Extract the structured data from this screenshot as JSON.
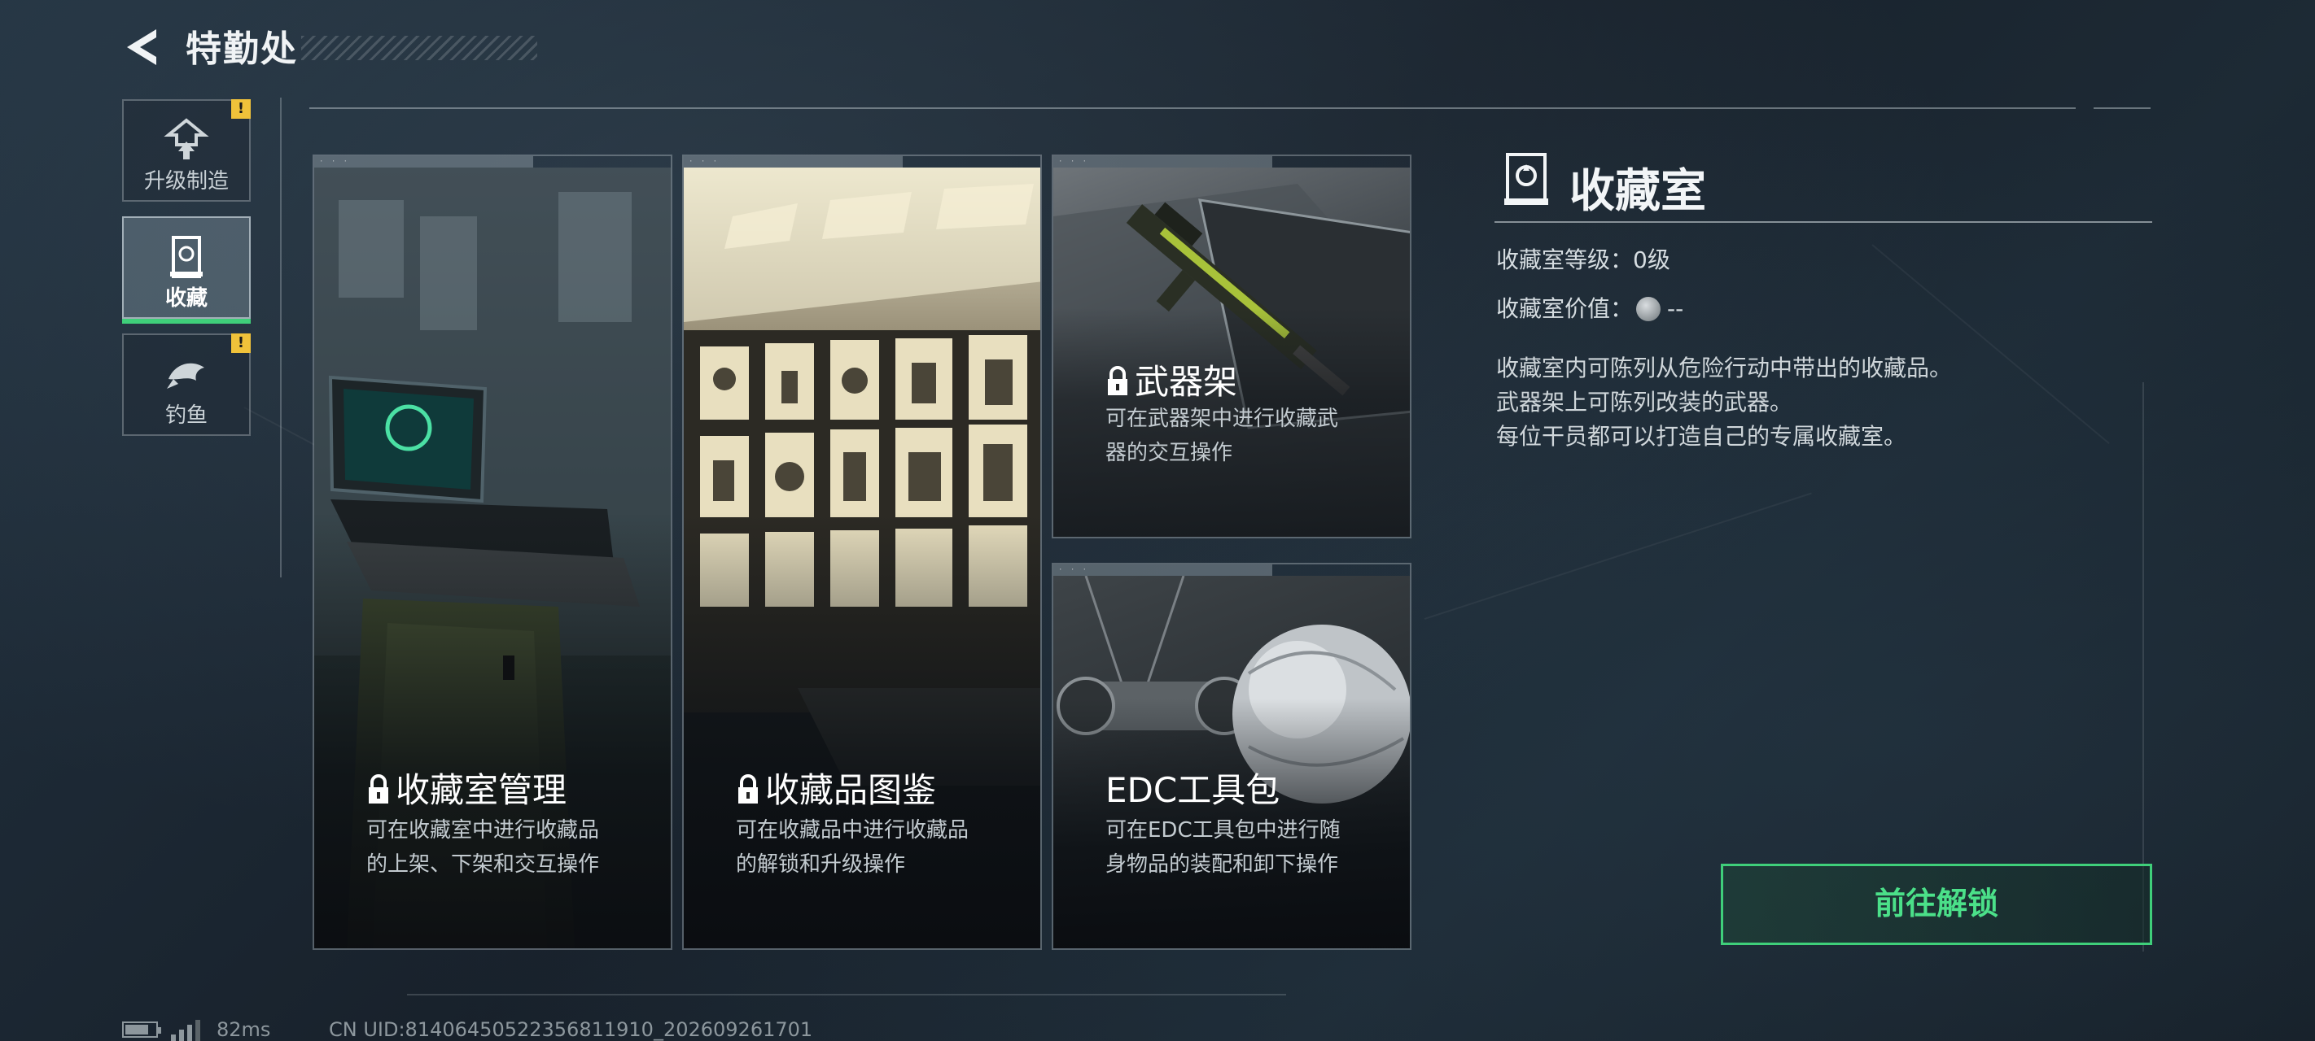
{
  "header": {
    "title": "特勤处",
    "back_icon": "back-arrow-icon"
  },
  "sidebar": {
    "items": [
      {
        "label": "升级制造",
        "icon": "upgrade-icon",
        "badge": "!",
        "active": false
      },
      {
        "label": "收藏",
        "icon": "collection-icon",
        "badge": "",
        "active": true
      },
      {
        "label": "钓鱼",
        "icon": "fish-icon",
        "badge": "!",
        "active": false
      }
    ]
  },
  "cards": [
    {
      "title": "收藏室管理",
      "locked": true,
      "desc": "可在收藏室中进行收藏品\n的上架、下架和交互操作"
    },
    {
      "title": "收藏品图鉴",
      "locked": true,
      "desc": "可在收藏品中进行收藏品\n的解锁和升级操作"
    },
    {
      "title": "武器架",
      "locked": true,
      "desc": "可在武器架中进行收藏武\n器的交互操作"
    },
    {
      "title": "EDC工具包",
      "locked": false,
      "desc": "可在EDC工具包中进行随\n身物品的装配和卸下操作"
    }
  ],
  "panel": {
    "title": "收藏室",
    "icon": "collection-room-icon",
    "level_label": "收藏室等级：",
    "level_value": "0级",
    "value_label": "收藏室价值：",
    "value_icon": "coin-icon",
    "value_value": "--",
    "desc_lines": [
      "收藏室内可陈列从危险行动中带出的收藏品。",
      "武器架上可陈列改装的武器。",
      "每位干员都可以打造自己的专属收藏室。"
    ],
    "cta_label": "前往解锁"
  },
  "status": {
    "ping": "82ms",
    "uid": "CN UID:8140645052235681​1910_202609261701"
  },
  "colors": {
    "accent_green": "#3fcf7a",
    "badge_yellow": "#f0c23a"
  }
}
